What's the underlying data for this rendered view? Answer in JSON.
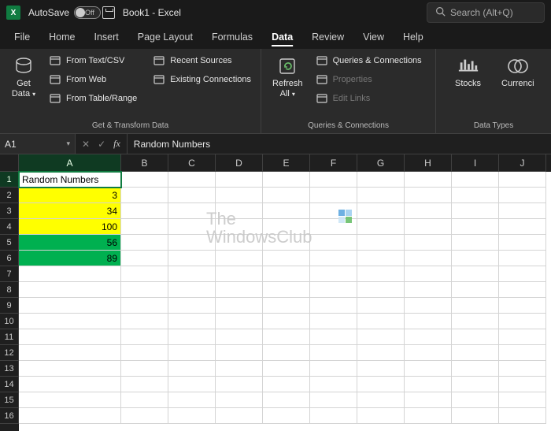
{
  "titlebar": {
    "autosave_label": "AutoSave",
    "autosave_state": "Off",
    "doc_title": "Book1  -  Excel",
    "search_placeholder": "Search (Alt+Q)"
  },
  "menu": {
    "items": [
      "File",
      "Home",
      "Insert",
      "Page Layout",
      "Formulas",
      "Data",
      "Review",
      "View",
      "Help"
    ],
    "active": "Data"
  },
  "ribbon": {
    "get_data": {
      "label": "Get\nData",
      "dropdown": true
    },
    "transform_items": [
      {
        "label": "From Text/CSV"
      },
      {
        "label": "From Web"
      },
      {
        "label": "From Table/Range"
      }
    ],
    "transform_items2": [
      {
        "label": "Recent Sources"
      },
      {
        "label": "Existing Connections"
      }
    ],
    "group1_label": "Get & Transform Data",
    "refresh": {
      "label": "Refresh\nAll",
      "dropdown": true
    },
    "qc_items": [
      {
        "label": "Queries & Connections",
        "disabled": false
      },
      {
        "label": "Properties",
        "disabled": true
      },
      {
        "label": "Edit Links",
        "disabled": true
      }
    ],
    "group2_label": "Queries & Connections",
    "stocks_label": "Stocks",
    "currencies_label": "Currenci",
    "group3_label": "Data Types"
  },
  "formula_bar": {
    "name_box": "A1",
    "fx_label": "fx",
    "value": "Random Numbers"
  },
  "sheet": {
    "col_widths": {
      "A": 130,
      "other": 60
    },
    "columns": [
      "A",
      "B",
      "C",
      "D",
      "E",
      "F",
      "G",
      "H",
      "I",
      "J"
    ],
    "active_cell": "A1",
    "rows_shown": 16,
    "cells": {
      "A1": {
        "value": "Random Numbers",
        "align": "left"
      },
      "A2": {
        "value": "3",
        "align": "right",
        "fill": "yellow"
      },
      "A3": {
        "value": "34",
        "align": "right",
        "fill": "yellow"
      },
      "A4": {
        "value": "100",
        "align": "right",
        "fill": "yellow"
      },
      "A5": {
        "value": "56",
        "align": "right",
        "fill": "green"
      },
      "A6": {
        "value": "89",
        "align": "right",
        "fill": "green"
      }
    }
  },
  "watermark": {
    "line1": "The",
    "line2": "WindowsClub"
  },
  "colors": {
    "accent": "#107c41",
    "yellow": "#ffff00",
    "green": "#00b050"
  }
}
